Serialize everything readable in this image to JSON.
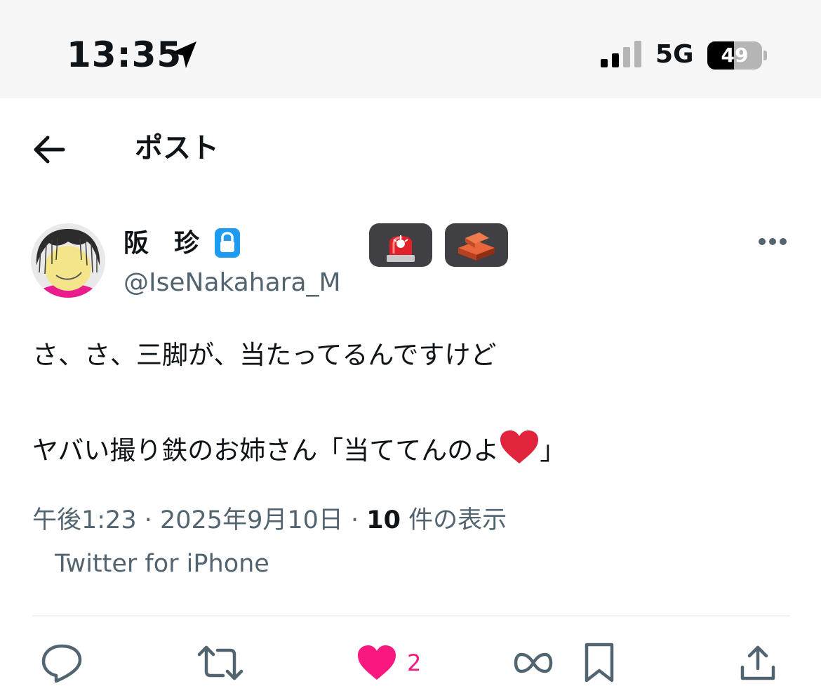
{
  "status_bar": {
    "time": "13:35",
    "network": "5G",
    "battery_level": "49",
    "battery_fraction": 0.49
  },
  "header": {
    "title": "ポスト"
  },
  "author": {
    "display_name": "阪　珍",
    "username": "@IseNakahara_M",
    "badges": [
      "police-light-emoji",
      "brick-emoji"
    ]
  },
  "tweet": {
    "line1": "さ、さ、三脚が、当たってるんですけど",
    "line2_prefix": "ヤバい撮り鉄のお姉さん「当ててんのよ",
    "line2_suffix": "」"
  },
  "meta": {
    "time": "午後1:23",
    "date": "2025年9月10日",
    "separator": " · ",
    "views_count": "10",
    "views_label": " 件の表示",
    "source": "Twitter for iPhone"
  },
  "actions": {
    "like_count": "2"
  },
  "colors": {
    "like": "#f91880",
    "secondary_text": "#536471",
    "icon_gray": "#536471",
    "lock_blue": "#1d9bf0",
    "badge_bg": "#3f3f44",
    "heart_red": "#e0243b"
  }
}
